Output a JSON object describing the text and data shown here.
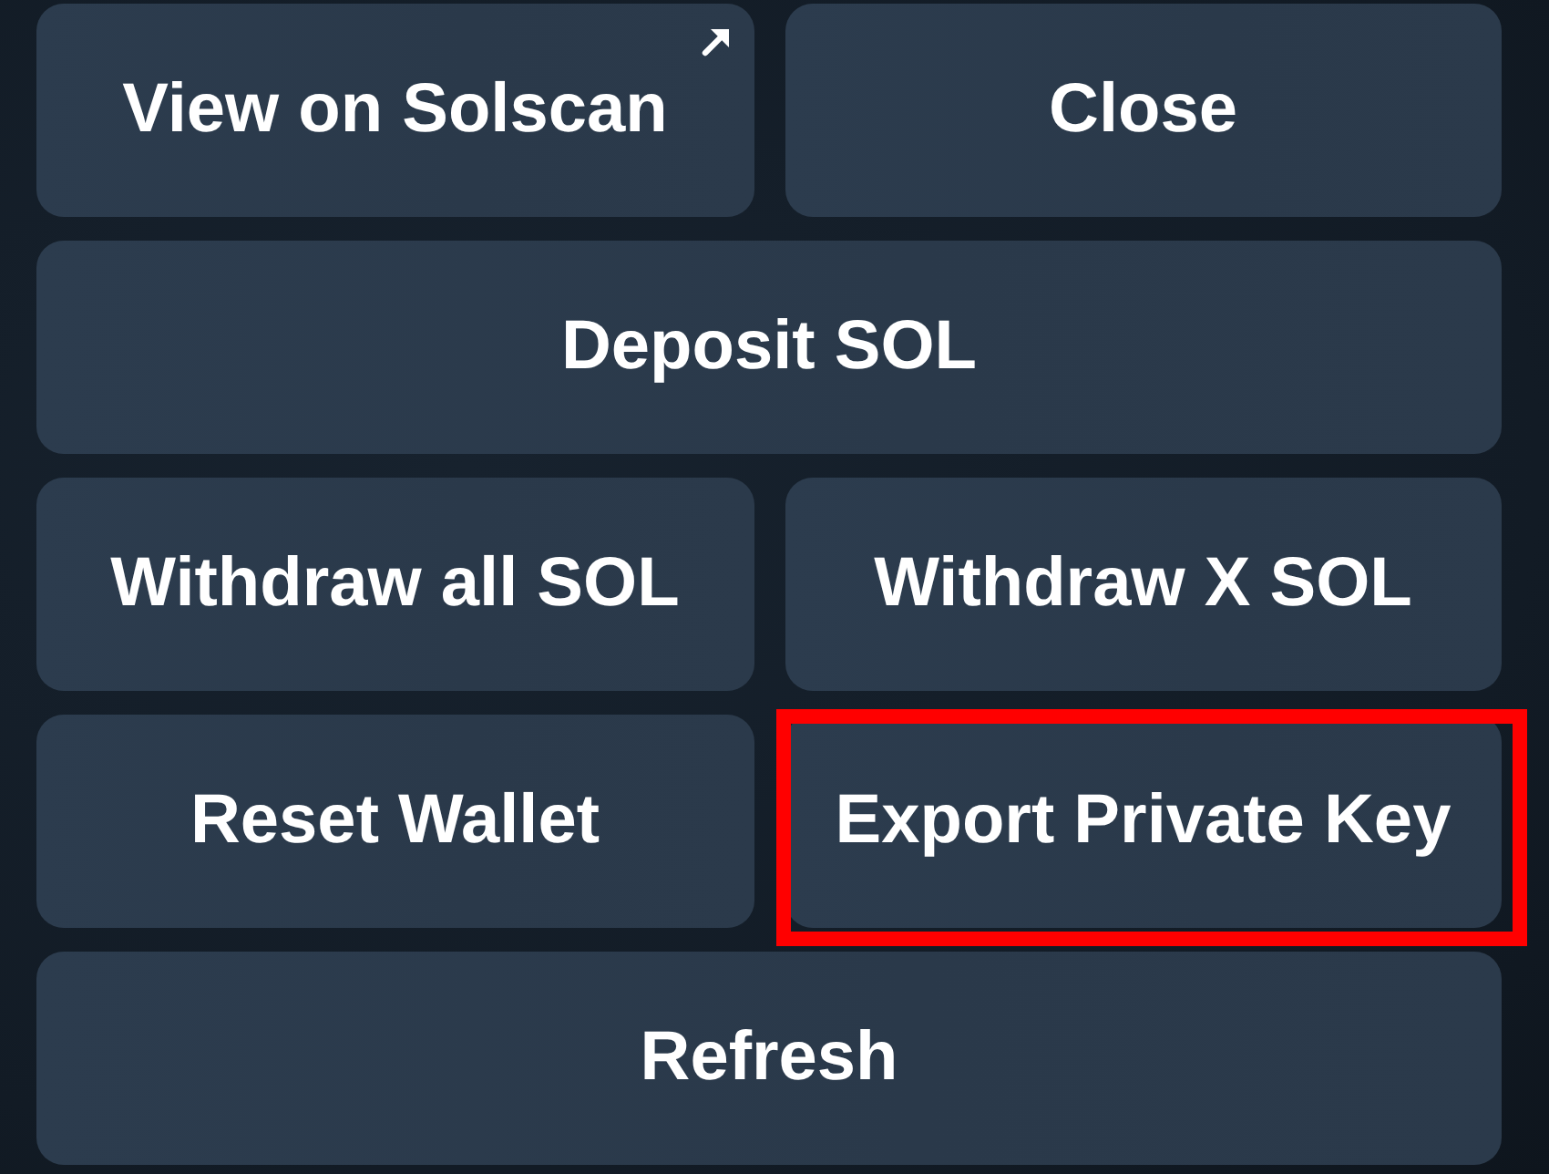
{
  "rows": [
    {
      "buttons": [
        {
          "label": "View on Solscan",
          "kind": "link",
          "highlighted": false
        },
        {
          "label": "Close",
          "kind": "action",
          "highlighted": false
        }
      ]
    },
    {
      "buttons": [
        {
          "label": "Deposit SOL",
          "kind": "action",
          "highlighted": false
        }
      ]
    },
    {
      "buttons": [
        {
          "label": "Withdraw all SOL",
          "kind": "action",
          "highlighted": false
        },
        {
          "label": "Withdraw X SOL",
          "kind": "action",
          "highlighted": false
        }
      ]
    },
    {
      "buttons": [
        {
          "label": "Reset Wallet",
          "kind": "action",
          "highlighted": false
        },
        {
          "label": "Export Private Key",
          "kind": "action",
          "highlighted": true
        }
      ]
    },
    {
      "buttons": [
        {
          "label": "Refresh",
          "kind": "action",
          "highlighted": false
        }
      ]
    }
  ]
}
